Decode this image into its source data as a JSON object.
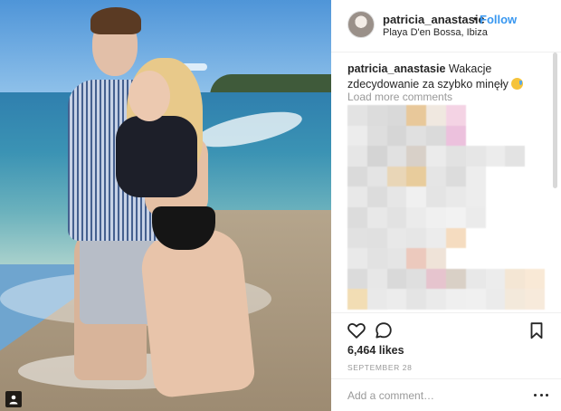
{
  "post": {
    "username": "patricia_anastasie",
    "separator": "•",
    "follow_label": "Follow",
    "location": "Playa D'en Bossa, Ibiza"
  },
  "caption": {
    "username": "patricia_anastasie",
    "text": "Wakacje zdecydowanie za szybko minęły",
    "emoji": "sweat-smile-emoji"
  },
  "comments": {
    "load_more_label": "Load more comments",
    "blurred_colors": [
      "#e3e3e3",
      "#dcdcdc",
      "#d9d9d9",
      "#e8c89a",
      "#f0e8e0",
      "#f4d3e4",
      "#ffffff",
      "#ffffff",
      "#ffffff",
      "#ffffff",
      "#ececec",
      "#dedede",
      "#d6d6d6",
      "#e0e0e0",
      "#dadada",
      "#ecc1dd",
      "#ffffff",
      "#ffffff",
      "#ffffff",
      "#ffffff",
      "#e6e6e6",
      "#d4d4d4",
      "#e1e1e1",
      "#d8d0c8",
      "#ebebeb",
      "#e2e2e2",
      "#e6e6e6",
      "#ececec",
      "#e3e3e3",
      "#ffffff",
      "#dadada",
      "#e4e4e4",
      "#e9d6b7",
      "#e8cc9c",
      "#e5e5e5",
      "#dcdcdc",
      "#ededed",
      "#ffffff",
      "#ffffff",
      "#ffffff",
      "#e8e8e8",
      "#dcdcdc",
      "#e6e6e6",
      "#f0f0f0",
      "#e4e4e4",
      "#e9e9e9",
      "#ededed",
      "#ffffff",
      "#ffffff",
      "#ffffff",
      "#dcdcdc",
      "#e8e8e8",
      "#e2e2e2",
      "#ebebeb",
      "#f0f0f0",
      "#f2f2f2",
      "#ebebeb",
      "#ffffff",
      "#ffffff",
      "#ffffff",
      "#e1e1e1",
      "#e0e0e0",
      "#e8e8e8",
      "#e6e6e6",
      "#ececec",
      "#f5dcc0",
      "#ffffff",
      "#ffffff",
      "#ffffff",
      "#ffffff",
      "#e9e9e9",
      "#e2e2e2",
      "#e5e5e5",
      "#ecc9bd",
      "#efe3d8",
      "#ffffff",
      "#ffffff",
      "#ffffff",
      "#ffffff",
      "#ffffff",
      "#dbdbdb",
      "#e7e7e7",
      "#d9d9d9",
      "#dfdfdf",
      "#e6c4ce",
      "#d9d0c6",
      "#e8e8e8",
      "#ececec",
      "#f4e6d4",
      "#f9e9d6",
      "#f2ddb4",
      "#e9e9e9",
      "#ececec",
      "#e4e4e4",
      "#eaeaea",
      "#efefef",
      "#f0f0f0",
      "#ebebeb",
      "#f3e9db",
      "#f7eadb"
    ]
  },
  "actions": {
    "like_icon": "heart-icon",
    "comment_icon": "comment-bubble-icon",
    "save_icon": "bookmark-icon",
    "likes_text": "6,464 likes",
    "date": "September 28"
  },
  "add_comment": {
    "placeholder": "Add a comment…",
    "more_icon": "more-options-icon"
  },
  "photo": {
    "user_tag_icon": "user-tag-icon"
  },
  "colors": {
    "link_blue": "#3897f0",
    "text": "#262626",
    "muted": "#999999",
    "divider": "#efefef"
  }
}
